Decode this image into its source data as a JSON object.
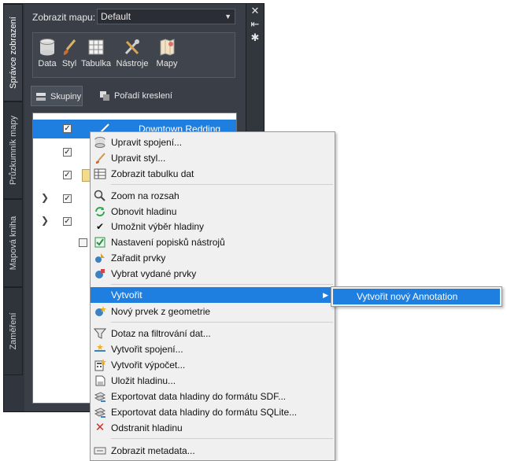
{
  "vtabs": [
    "Správce zobrazení",
    "Průzkumník mapy",
    "Mapová kniha",
    "Zaměření"
  ],
  "titlebar_icons": [
    "close-icon",
    "collapse-icon",
    "settings-icon"
  ],
  "map_label": "Zobrazit mapu:",
  "map_select": "Default",
  "ribbon": [
    "Data",
    "Styl",
    "Tabulka",
    "Nástroje",
    "Mapy"
  ],
  "tabs": [
    "Skupiny",
    "Pořadí kreslení"
  ],
  "tree": {
    "selected_layer": "Downtown Redding"
  },
  "menu": {
    "items": [
      "Upravit spojení...",
      "Upravit styl...",
      "Zobrazit tabulku dat",
      "Zoom na rozsah",
      "Obnovit hladinu",
      "Umožnit výběr hladiny",
      "Nastavení popisků nástrojů",
      "Zařadit prvky",
      "Vybrat vydané prvky",
      "Vytvořit",
      "Nový prvek z geometrie",
      "Dotaz na filtrování dat...",
      "Vytvořit spojení...",
      "Vytvořit výpočet...",
      "Uložit hladinu...",
      "Exportovat data hladiny do formátu SDF...",
      "Exportovat data hladiny do formátu SQLite...",
      "Odstranit hladinu",
      "Zobrazit metadata..."
    ]
  },
  "submenu": {
    "item": "Vytvořit nový Annotation"
  },
  "colors": {
    "highlight": "#1f7fe0",
    "panel": "#3a3f47",
    "menu_bg": "#f0f0f0"
  }
}
